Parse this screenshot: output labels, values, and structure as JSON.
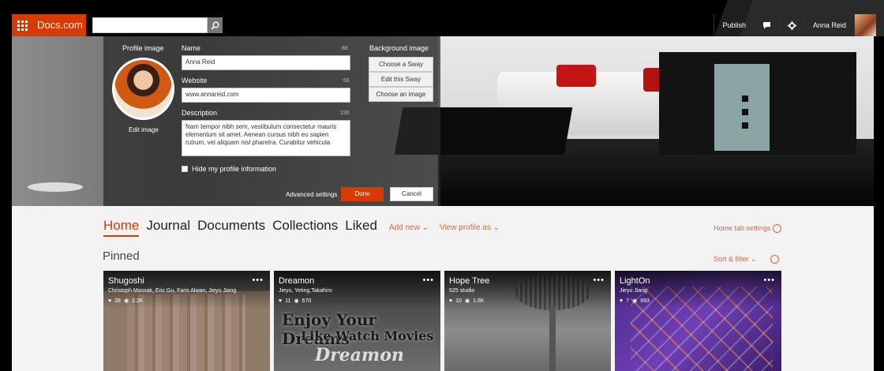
{
  "topbar": {
    "brand": "Docs.com",
    "search": {
      "placeholder": "",
      "value": ""
    },
    "publish_label": "Publish",
    "user_name": "Anna Reid"
  },
  "profile_editor": {
    "profile_image_label": "Profile image",
    "edit_image_label": "Edit image",
    "name_label": "Name",
    "name_count": "88",
    "name_value": "Anna Reid",
    "website_label": "Website",
    "website_count": "66",
    "website_value": "www.annareid.com",
    "description_label": "Description",
    "description_count": "230",
    "description_value": "Nam tempor nibh sem, vestibulum consectetur mauris elementum sit amet. Aenean cursus nibh eu sapien rutrum, vel aliquam nisl pharetra. Curabitur vehicula",
    "hide_profile_label": "Hide my profile information",
    "hide_profile_checked": false,
    "background_image_label": "Background image",
    "choose_sway_label": "Choose a Sway",
    "edit_sway_label": "Edit this Sway",
    "choose_image_label": "Choose an image",
    "advanced_settings_label": "Advanced settings",
    "done_label": "Done",
    "cancel_label": "Cancel"
  },
  "nav": {
    "tabs": [
      {
        "label": "Home",
        "active": true
      },
      {
        "label": "Journal",
        "active": false
      },
      {
        "label": "Documents",
        "active": false
      },
      {
        "label": "Collections",
        "active": false
      },
      {
        "label": "Liked",
        "active": false
      }
    ],
    "add_new_label": "Add new",
    "view_profile_as_label": "View profile as",
    "home_tab_settings_label": "Home tab settings"
  },
  "pinned": {
    "heading": "Pinned",
    "sort_filter_label": "Sort & filter",
    "cards": [
      {
        "title": "Shugoshi",
        "authors": "Christoph Massak, Eric Gu, Faris Alwan, Jieyu Jiang",
        "likes": "28",
        "views": "2.2K"
      },
      {
        "title": "Dreamon",
        "authors": "Jieyu, Yeting,Takahiro",
        "likes": "11",
        "views": "670",
        "art_line1": "Enjoy Your Dreams",
        "art_line2": "Like Watch Movies",
        "art_line3": "Dreamon"
      },
      {
        "title": "Hope Tree",
        "authors": "525 studio",
        "likes": "10",
        "views": "1.6K"
      },
      {
        "title": "LightOn",
        "authors": "Jieyu Jiang",
        "likes": "7",
        "views": "993"
      }
    ]
  },
  "colors": {
    "accent": "#d83b01",
    "link": "#d86a3f",
    "topbar_bg": "#000000",
    "content_bg": "#f3f3f3"
  },
  "icons": [
    "app-launcher-icon",
    "search-icon",
    "chat-icon",
    "gear-icon",
    "chevron-down-icon",
    "heart-icon",
    "eye-icon",
    "more-icon"
  ]
}
